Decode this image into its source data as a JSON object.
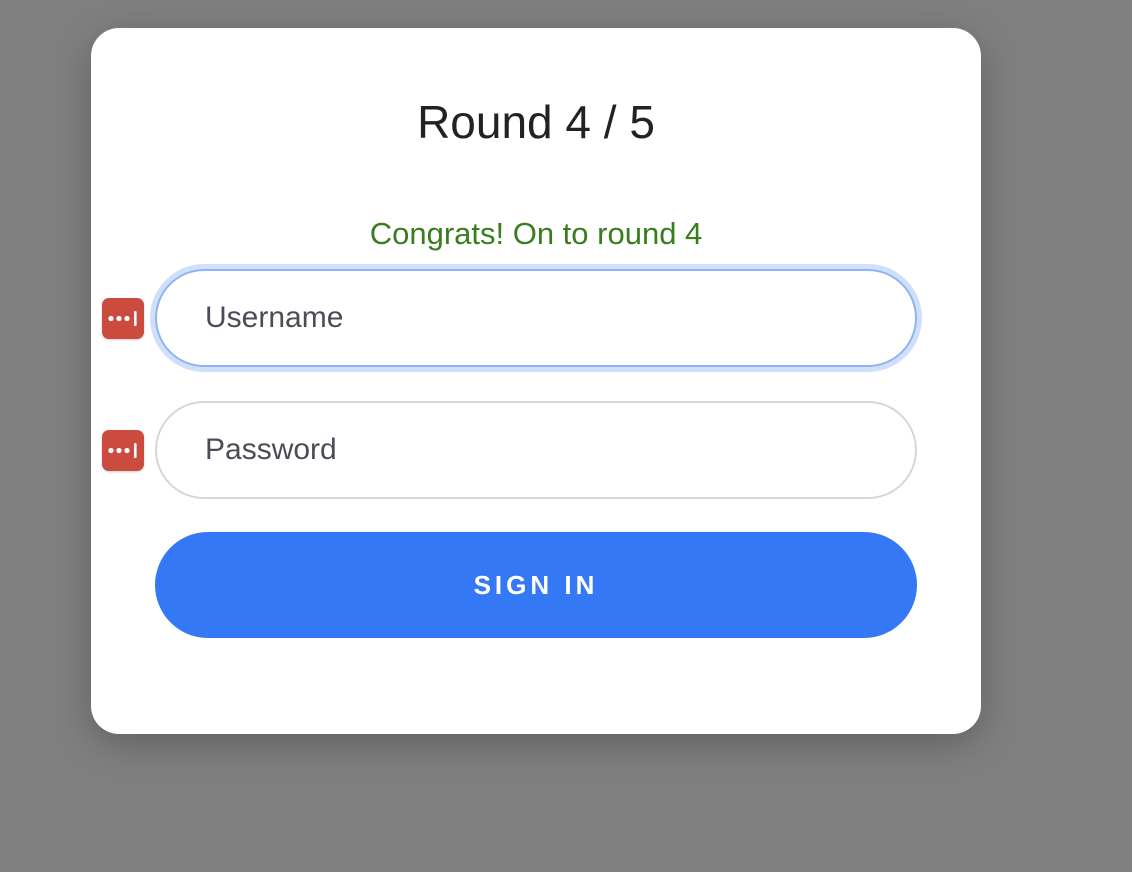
{
  "dialog": {
    "title": "Round 4 / 5",
    "status_message": "Congrats! On to round 4"
  },
  "form": {
    "username": {
      "placeholder": "Username",
      "value": ""
    },
    "password": {
      "placeholder": "Password",
      "value": ""
    },
    "submit_label": "SIGN IN"
  },
  "icons": {
    "password_manager": "password-manager-icon"
  },
  "colors": {
    "backdrop": "#808080",
    "card": "#ffffff",
    "status_text": "#3a7d1f",
    "primary_button": "#3578f5",
    "password_manager_icon": "#cb4b3f",
    "focus_ring": "#cfe0fb"
  }
}
